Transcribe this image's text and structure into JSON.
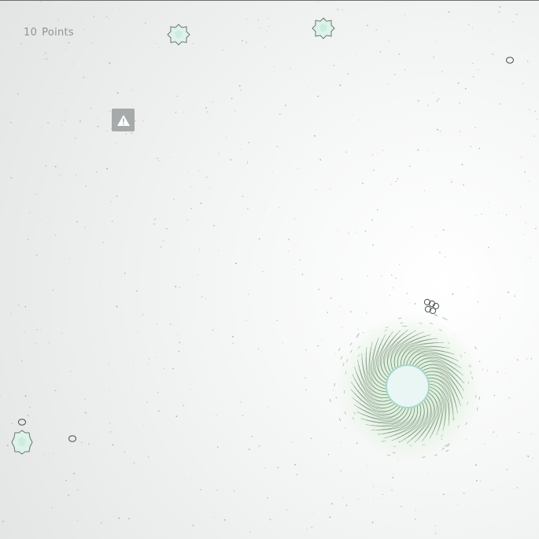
{
  "hud": {
    "score_value": "10",
    "score_label": "Points"
  },
  "icons": {
    "alert": "warning-triangle-icon"
  },
  "colors": {
    "background": "#f1f2f2",
    "hud_text": "#8e9393",
    "alert_button": "#a7aaaa",
    "crystal_fill": "#ddf3ea",
    "vortex_glow": "#cfeecf",
    "vortex_core": "#e9f6f3",
    "vortex_rim": "#a8d8cf",
    "swirl_stroke": "#5a5f5f"
  }
}
